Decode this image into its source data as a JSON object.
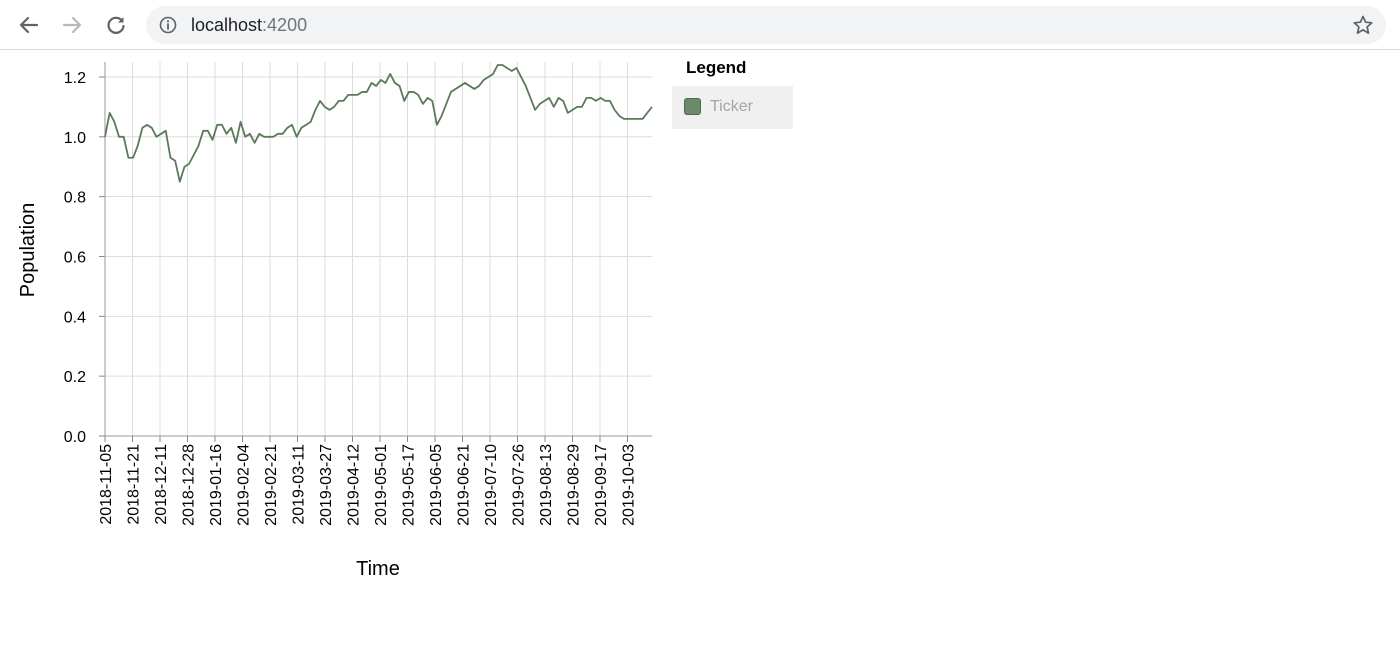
{
  "browser": {
    "url_host": "localhost",
    "url_port": ":4200",
    "icons": {
      "back": "arrow-left-icon",
      "forward": "arrow-right-icon",
      "reload": "reload-icon",
      "info": "info-icon",
      "bookmark": "star-icon"
    }
  },
  "legend": {
    "title": "Legend",
    "items": [
      {
        "label": "Ticker",
        "color": "#6b8a6b"
      }
    ]
  },
  "chart_data": {
    "type": "line",
    "xlabel": "Time",
    "ylabel": "Population",
    "ylim": [
      0,
      1.25
    ],
    "yticks": [
      "0.0",
      "0.2",
      "0.4",
      "0.6",
      "0.8",
      "1.0",
      "1.2"
    ],
    "grid": true,
    "legend_position": "right",
    "line_color": "#5a7a5a",
    "x_tick_labels": [
      "2018-11-05",
      "2018-11-21",
      "2018-12-11",
      "2018-12-28",
      "2019-01-16",
      "2019-02-04",
      "2019-02-21",
      "2019-03-11",
      "2019-03-27",
      "2019-04-12",
      "2019-05-01",
      "2019-05-17",
      "2019-06-05",
      "2019-06-21",
      "2019-07-10",
      "2019-07-26",
      "2019-08-13",
      "2019-08-29",
      "2019-09-17",
      "2019-10-03"
    ],
    "series": [
      {
        "name": "Ticker",
        "values": [
          1.0,
          1.08,
          1.05,
          1.0,
          1.0,
          0.93,
          0.93,
          0.97,
          1.03,
          1.04,
          1.03,
          1.0,
          1.01,
          1.02,
          0.93,
          0.92,
          0.85,
          0.9,
          0.91,
          0.94,
          0.97,
          1.02,
          1.02,
          0.99,
          1.04,
          1.04,
          1.01,
          1.03,
          0.98,
          1.05,
          1.0,
          1.01,
          0.98,
          1.01,
          1.0,
          1.0,
          1.0,
          1.01,
          1.01,
          1.03,
          1.04,
          1.0,
          1.03,
          1.04,
          1.05,
          1.09,
          1.12,
          1.1,
          1.09,
          1.1,
          1.12,
          1.12,
          1.14,
          1.14,
          1.14,
          1.15,
          1.15,
          1.18,
          1.17,
          1.19,
          1.18,
          1.21,
          1.18,
          1.17,
          1.12,
          1.15,
          1.15,
          1.14,
          1.11,
          1.13,
          1.12,
          1.04,
          1.07,
          1.11,
          1.15,
          1.16,
          1.17,
          1.18,
          1.17,
          1.16,
          1.17,
          1.19,
          1.2,
          1.21,
          1.24,
          1.24,
          1.23,
          1.22,
          1.23,
          1.2,
          1.17,
          1.13,
          1.09,
          1.11,
          1.12,
          1.13,
          1.1,
          1.13,
          1.12,
          1.08,
          1.09,
          1.1,
          1.1,
          1.13,
          1.13,
          1.12,
          1.13,
          1.12,
          1.12,
          1.09,
          1.07,
          1.06,
          1.06,
          1.06,
          1.06,
          1.06,
          1.08,
          1.1
        ]
      }
    ]
  }
}
